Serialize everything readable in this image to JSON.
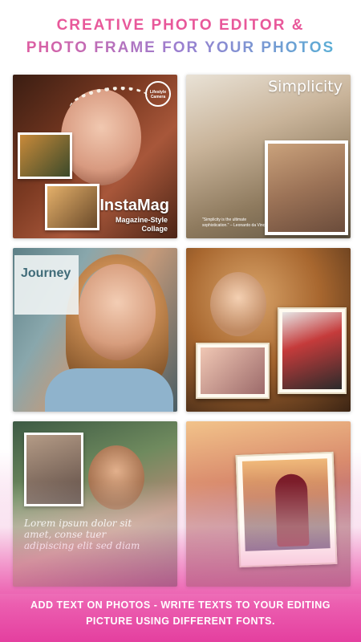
{
  "headline": {
    "line1": "CREATIVE PHOTO EDITOR &",
    "line2": "PHOTO FRAME FOR YOUR PHOTOS"
  },
  "cards": {
    "instamag": {
      "badge": "Lifestyle Camera",
      "title": "InstaMag",
      "subtitle_line1": "Magazine-Style",
      "subtitle_line2": "Collage"
    },
    "simplicity": {
      "title": "Simplicity",
      "quote": "\"Simplicity is the ultimate sophistication.\" – Leonardo da Vinci"
    },
    "journey": {
      "title": "Journey"
    },
    "text_overlay": {
      "lorem": "Lorem ipsum dolor sit amet, conse tuer adipiscing elit sed diam"
    }
  },
  "caption": {
    "line1": "ADD TEXT ON PHOTOS - WRITE TEXTS TO YOUR EDITING",
    "line2": "PICTURE USING DIFFERENT FONTS."
  },
  "colors": {
    "accent_pink": "#e8589a",
    "gradient_blue": "#4fb6d6",
    "footer_pink": "#e43f9f"
  }
}
